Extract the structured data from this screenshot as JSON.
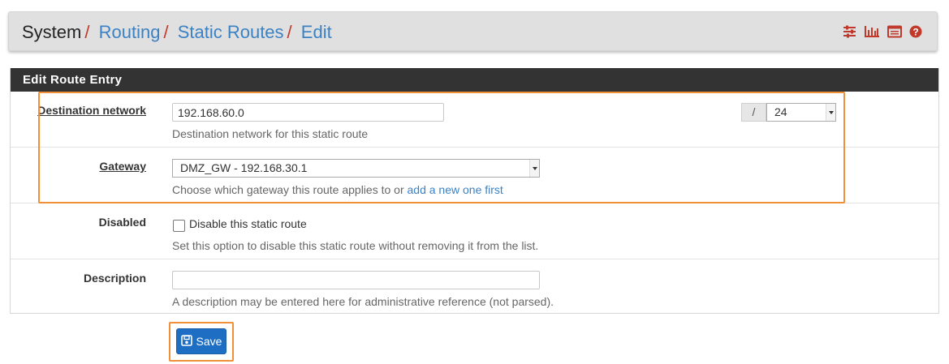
{
  "breadcrumb": {
    "system": "System",
    "routing": "Routing",
    "static_routes": "Static Routes",
    "edit": "Edit",
    "separator": "/"
  },
  "top_icons": [
    "sliders-icon",
    "bar-chart-icon",
    "list-alt-icon",
    "help-icon"
  ],
  "colors": {
    "accent_red": "#c0392b",
    "link_blue": "#3b82c4",
    "highlight_orange": "#f0913a",
    "primary_button": "#1e6fc4",
    "panel_header": "#333333"
  },
  "panel": {
    "title": "Edit Route Entry"
  },
  "form": {
    "destination": {
      "label": "Destination network",
      "value": "192.168.60.0",
      "slash": "/",
      "mask": "24",
      "help": "Destination network for this static route"
    },
    "gateway": {
      "label": "Gateway",
      "selected": "DMZ_GW - 192.168.30.1",
      "help": "Choose which gateway this route applies to or ",
      "help_link": "add a new one first"
    },
    "disabled": {
      "label": "Disabled",
      "checkbox_label": "Disable this static route",
      "checked": false,
      "help": "Set this option to disable this static route without removing it from the list."
    },
    "description": {
      "label": "Description",
      "value": "",
      "help": "A description may be entered here for administrative reference (not parsed)."
    }
  },
  "save_button": {
    "label": "Save",
    "icon": "save-icon"
  }
}
